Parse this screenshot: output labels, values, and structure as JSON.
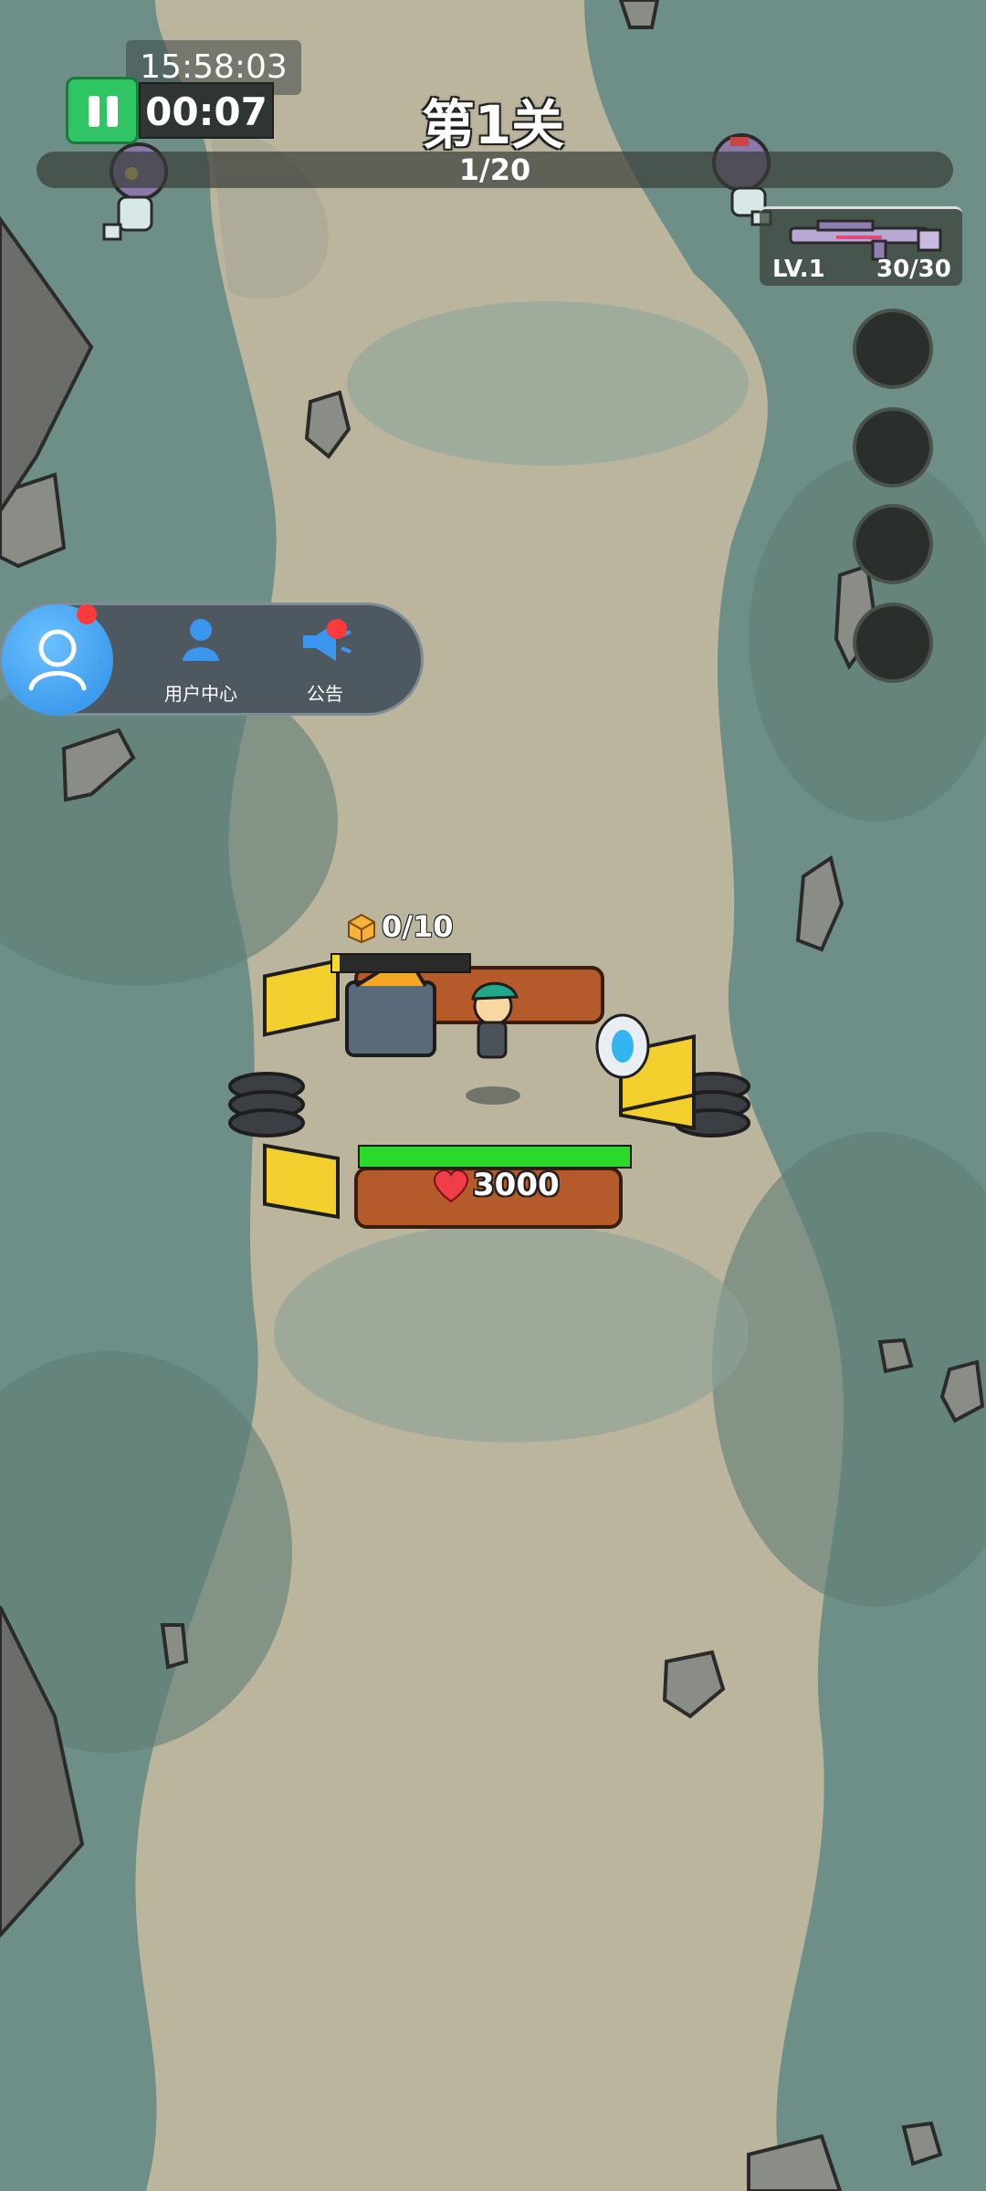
{
  "hud": {
    "clock": "15:58:03",
    "timer": "00:07",
    "level_title": "第1关",
    "wave_progress": "1/20"
  },
  "weapon": {
    "level": "LV.1",
    "ammo": "30/30"
  },
  "float_menu": {
    "user_center_label": "用户中心",
    "notice_label": "公告"
  },
  "base": {
    "crate_count": "0/10",
    "crate_progress": 0.05,
    "hp": "3000",
    "hp_fill": 1.0
  },
  "icons": {
    "pause": "pause-icon",
    "user": "user-icon",
    "notice": "megaphone-icon",
    "crate": "crate-icon",
    "heart": "heart-icon",
    "gun": "rifle-icon"
  },
  "colors": {
    "hp_bar": "#2bd92b",
    "crate_bar": "#f2dc27",
    "pause_button": "#2fc564",
    "menu_accent": "#3a96ee"
  }
}
